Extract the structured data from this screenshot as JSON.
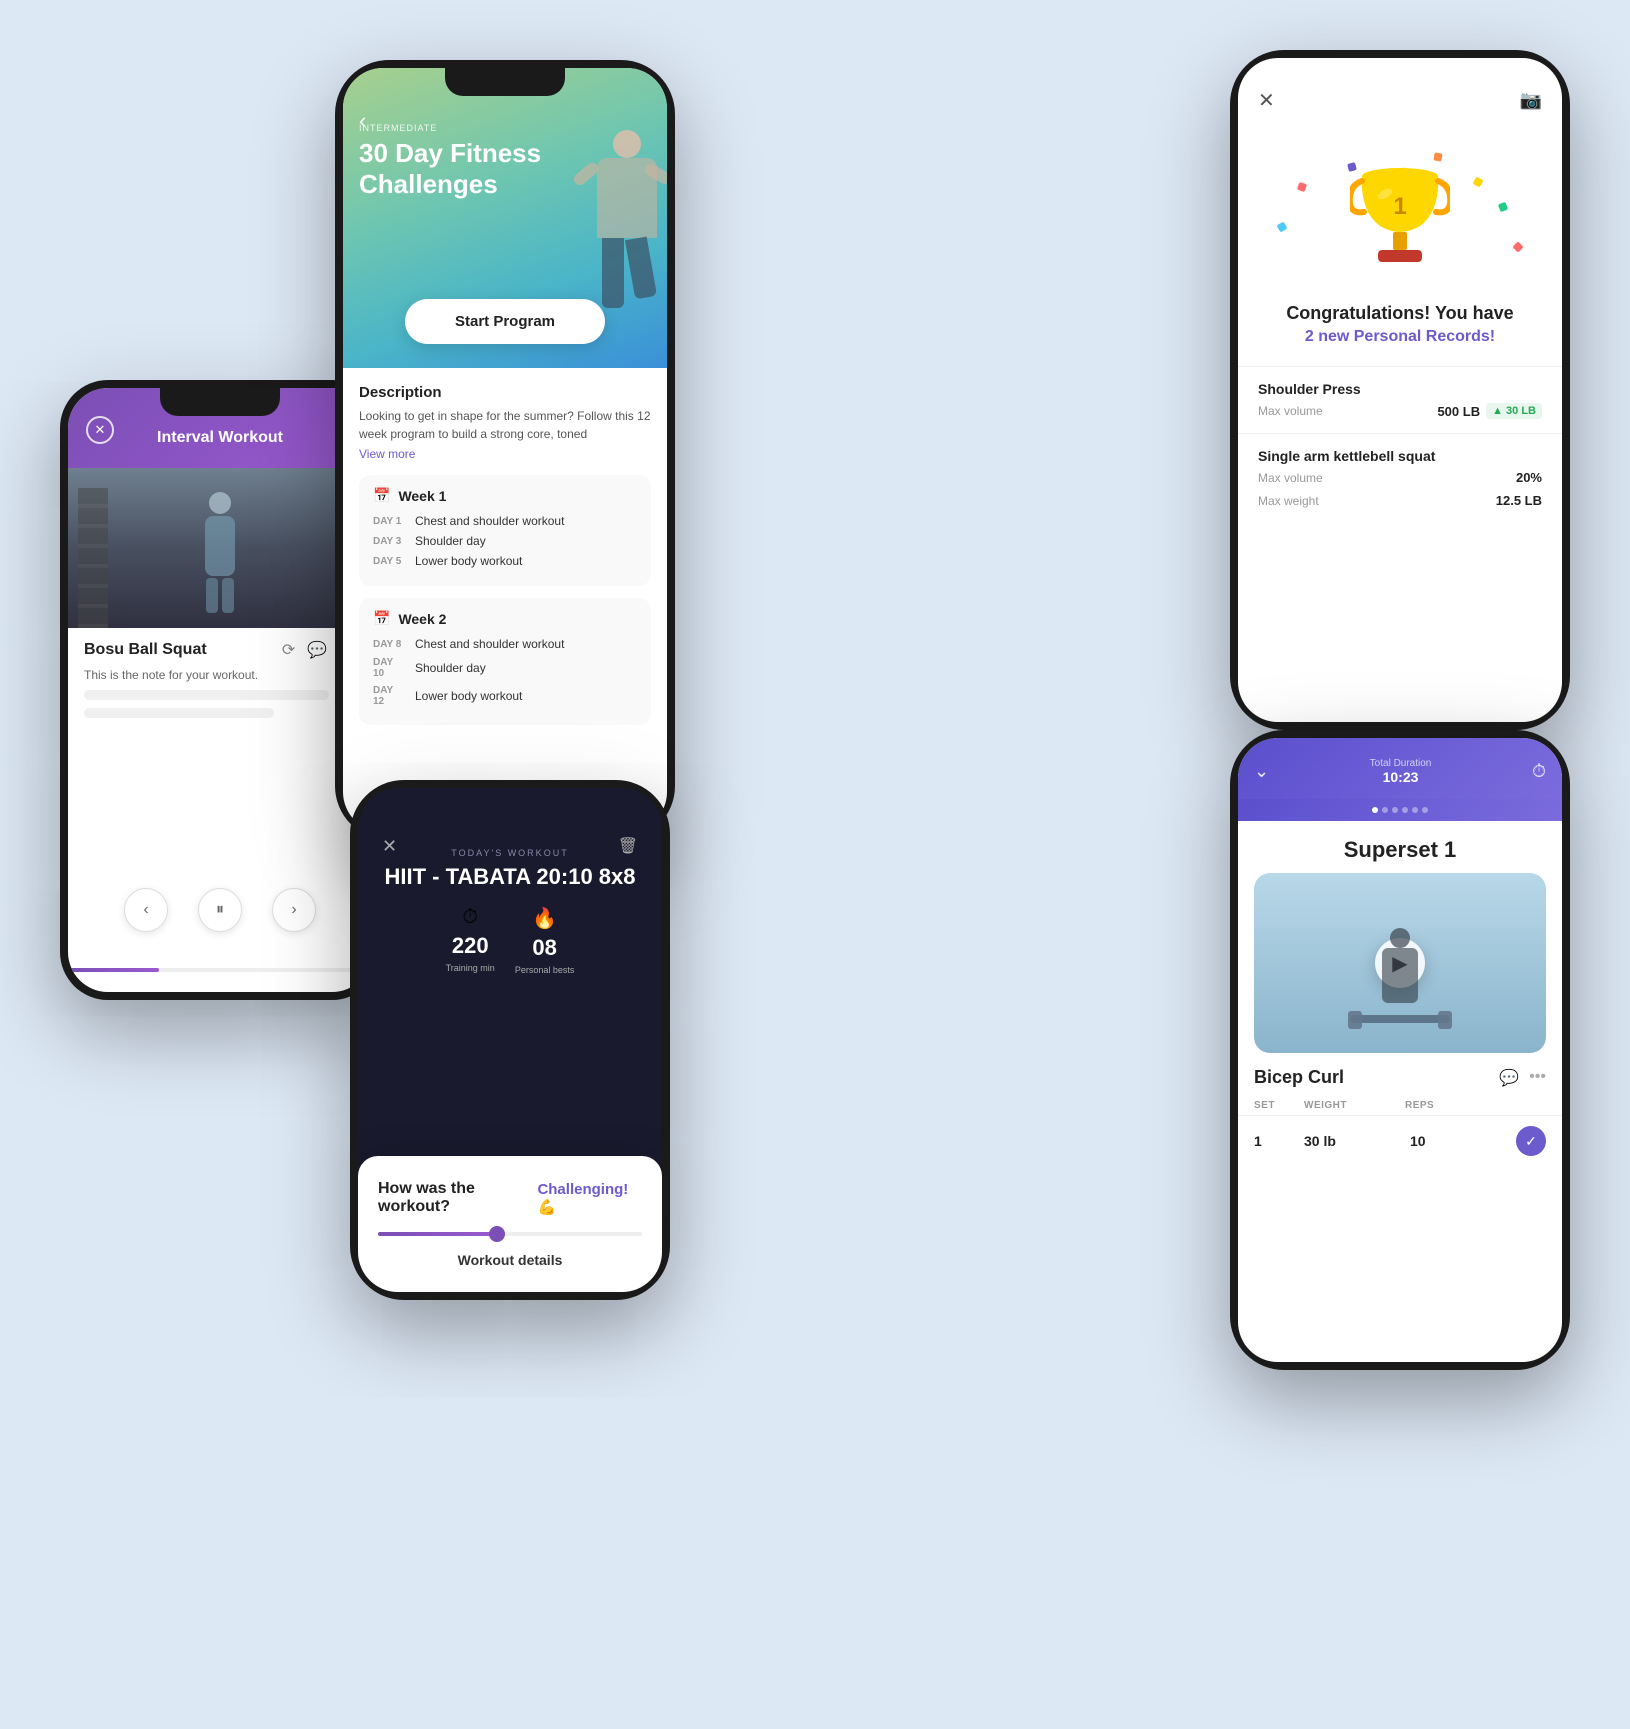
{
  "bg_color": "#dde8f5",
  "phone1": {
    "title": "Interval Workout",
    "exercise_name": "Bosu Ball Squat",
    "note_label": "",
    "note_text": "This is the note for your workout.",
    "controls": [
      "‹",
      "⏸",
      "›"
    ]
  },
  "phone2": {
    "badge": "INTERMEDIATE",
    "hero_title": "30 Day Fitness\nChallenges",
    "start_button": "Start Program",
    "description_title": "Description",
    "description": "Looking to get in shape for the summer? Follow this 12 week program to build a strong core, toned",
    "view_more": "View more",
    "weeks": [
      {
        "label": "Week 1",
        "days": [
          {
            "day": "DAY 1",
            "name": "Chest and shoulder workout"
          },
          {
            "day": "DAY 3",
            "name": "Shoulder day"
          },
          {
            "day": "DAY 5",
            "name": "Lower body workout"
          }
        ]
      },
      {
        "label": "Week 2",
        "days": [
          {
            "day": "DAY 8",
            "name": "Chest and shoulder workout"
          },
          {
            "day": "DAY 10",
            "name": "Shoulder day"
          },
          {
            "day": "DAY 12",
            "name": "Lower body workout"
          }
        ]
      }
    ]
  },
  "phone3": {
    "congrats_title": "Congratulations! You have",
    "congrats_sub": "2 new Personal Records!",
    "records": [
      {
        "name": "Shoulder Press",
        "rows": [
          {
            "label": "Max volume",
            "value": "500 LB",
            "gain": "▲ 30 LB"
          }
        ]
      },
      {
        "name": "Single arm kettlebell squat",
        "rows": [
          {
            "label": "Max volume",
            "value": "20%"
          },
          {
            "label": "Max weight",
            "value": "12.5 LB"
          }
        ]
      }
    ]
  },
  "phone4": {
    "today_label": "TODAY'S WORKOUT",
    "workout_name": "HIIT - TABATA 20:10 8x8",
    "stats": [
      {
        "icon": "⏱",
        "value": "220",
        "label": "Training min"
      },
      {
        "icon": "🔥",
        "value": "08",
        "label": "Personal bests"
      }
    ],
    "rating_question": "How was the workout?",
    "rating_answer": "Challenging! 💪",
    "workout_details_label": "Workout details"
  },
  "phone5": {
    "duration_label": "Total Duration",
    "duration_value": "10:23",
    "superset_title": "Superset 1",
    "exercise_name": "Bicep Curl",
    "table_headers": [
      "SET",
      "WEIGHT",
      "REPS",
      ""
    ],
    "sets": [
      {
        "set": "1",
        "weight": "30 lb",
        "reps": "10",
        "done": true
      }
    ]
  }
}
